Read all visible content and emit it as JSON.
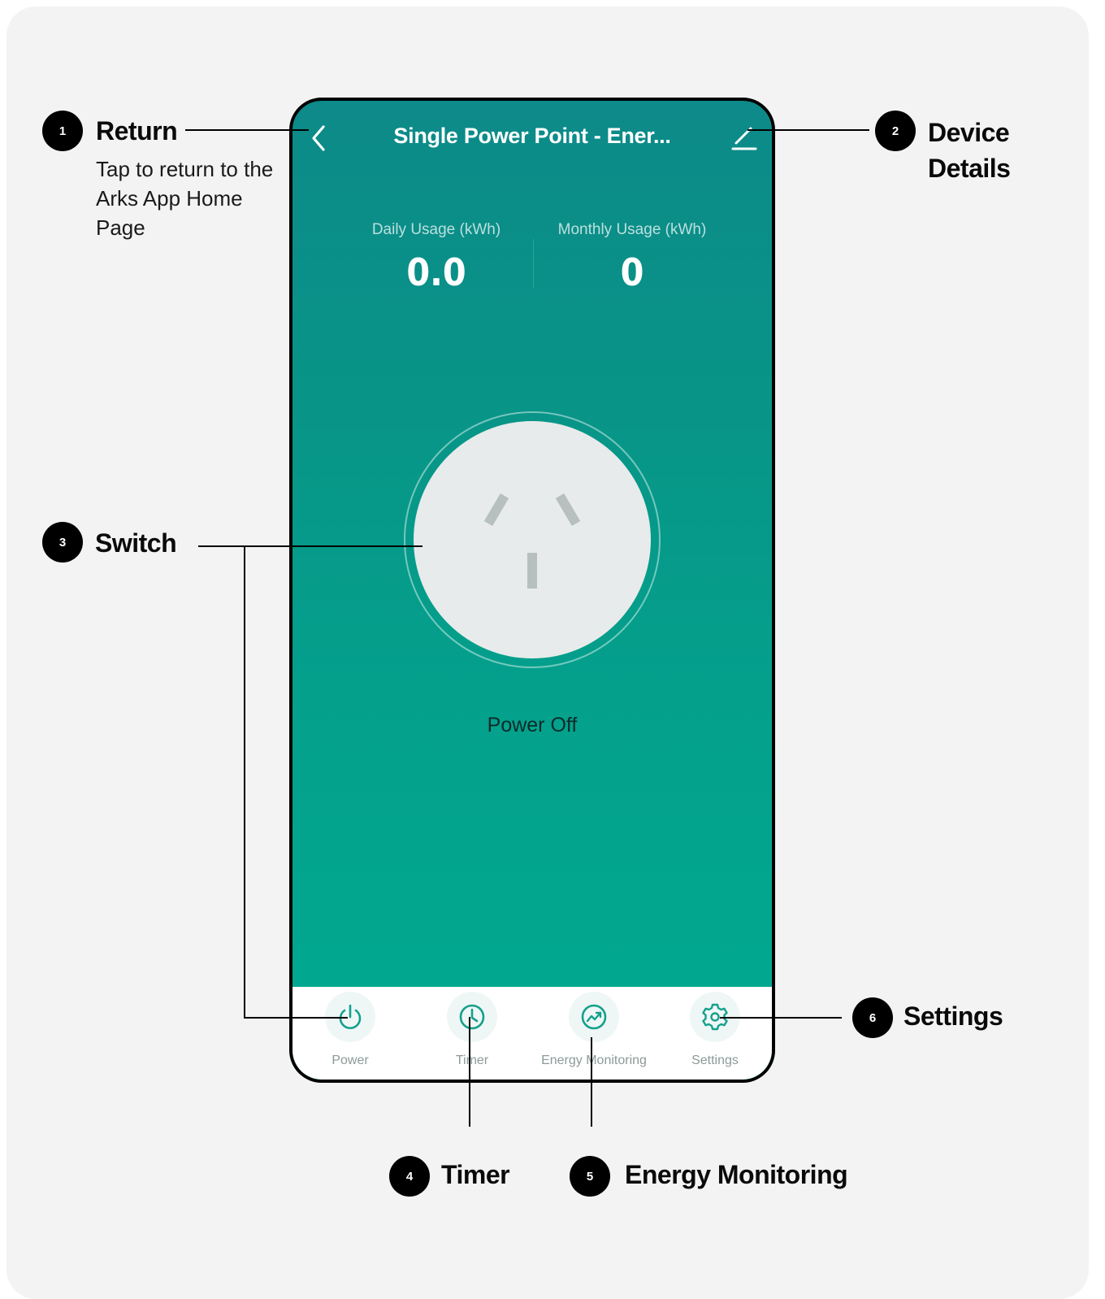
{
  "header": {
    "title": "Single Power Point - Ener...",
    "back_icon": "chevron-left-icon",
    "edit_icon": "pencil-icon"
  },
  "usage": {
    "daily_label": "Daily Usage (kWh)",
    "daily_value": "0.0",
    "monthly_label": "Monthly Usage (kWh)",
    "monthly_value": "0"
  },
  "switch": {
    "status": "Power Off",
    "icon": "power-socket-icon"
  },
  "tabs": [
    {
      "label": "Power",
      "icon": "power-icon"
    },
    {
      "label": "Timer",
      "icon": "clock-icon"
    },
    {
      "label": "Energy Monitoring",
      "icon": "trend-chart-icon"
    },
    {
      "label": "Settings",
      "icon": "gear-icon"
    }
  ],
  "callouts": {
    "return": {
      "number": "1",
      "title": "Return",
      "description": "Tap to return to the Arks App Home Page"
    },
    "device_details": {
      "number": "2",
      "title": "Device Details"
    },
    "switch": {
      "number": "3",
      "title": "Switch"
    },
    "timer": {
      "number": "4",
      "title": "Timer"
    },
    "energy_monitoring": {
      "number": "5",
      "title": "Energy Monitoring"
    },
    "settings": {
      "number": "6",
      "title": "Settings"
    }
  },
  "colors": {
    "teal_top": "#0d8a89",
    "teal_bottom": "#00aa90",
    "accent": "#14a08c",
    "card_bg": "#f3f3f3"
  }
}
